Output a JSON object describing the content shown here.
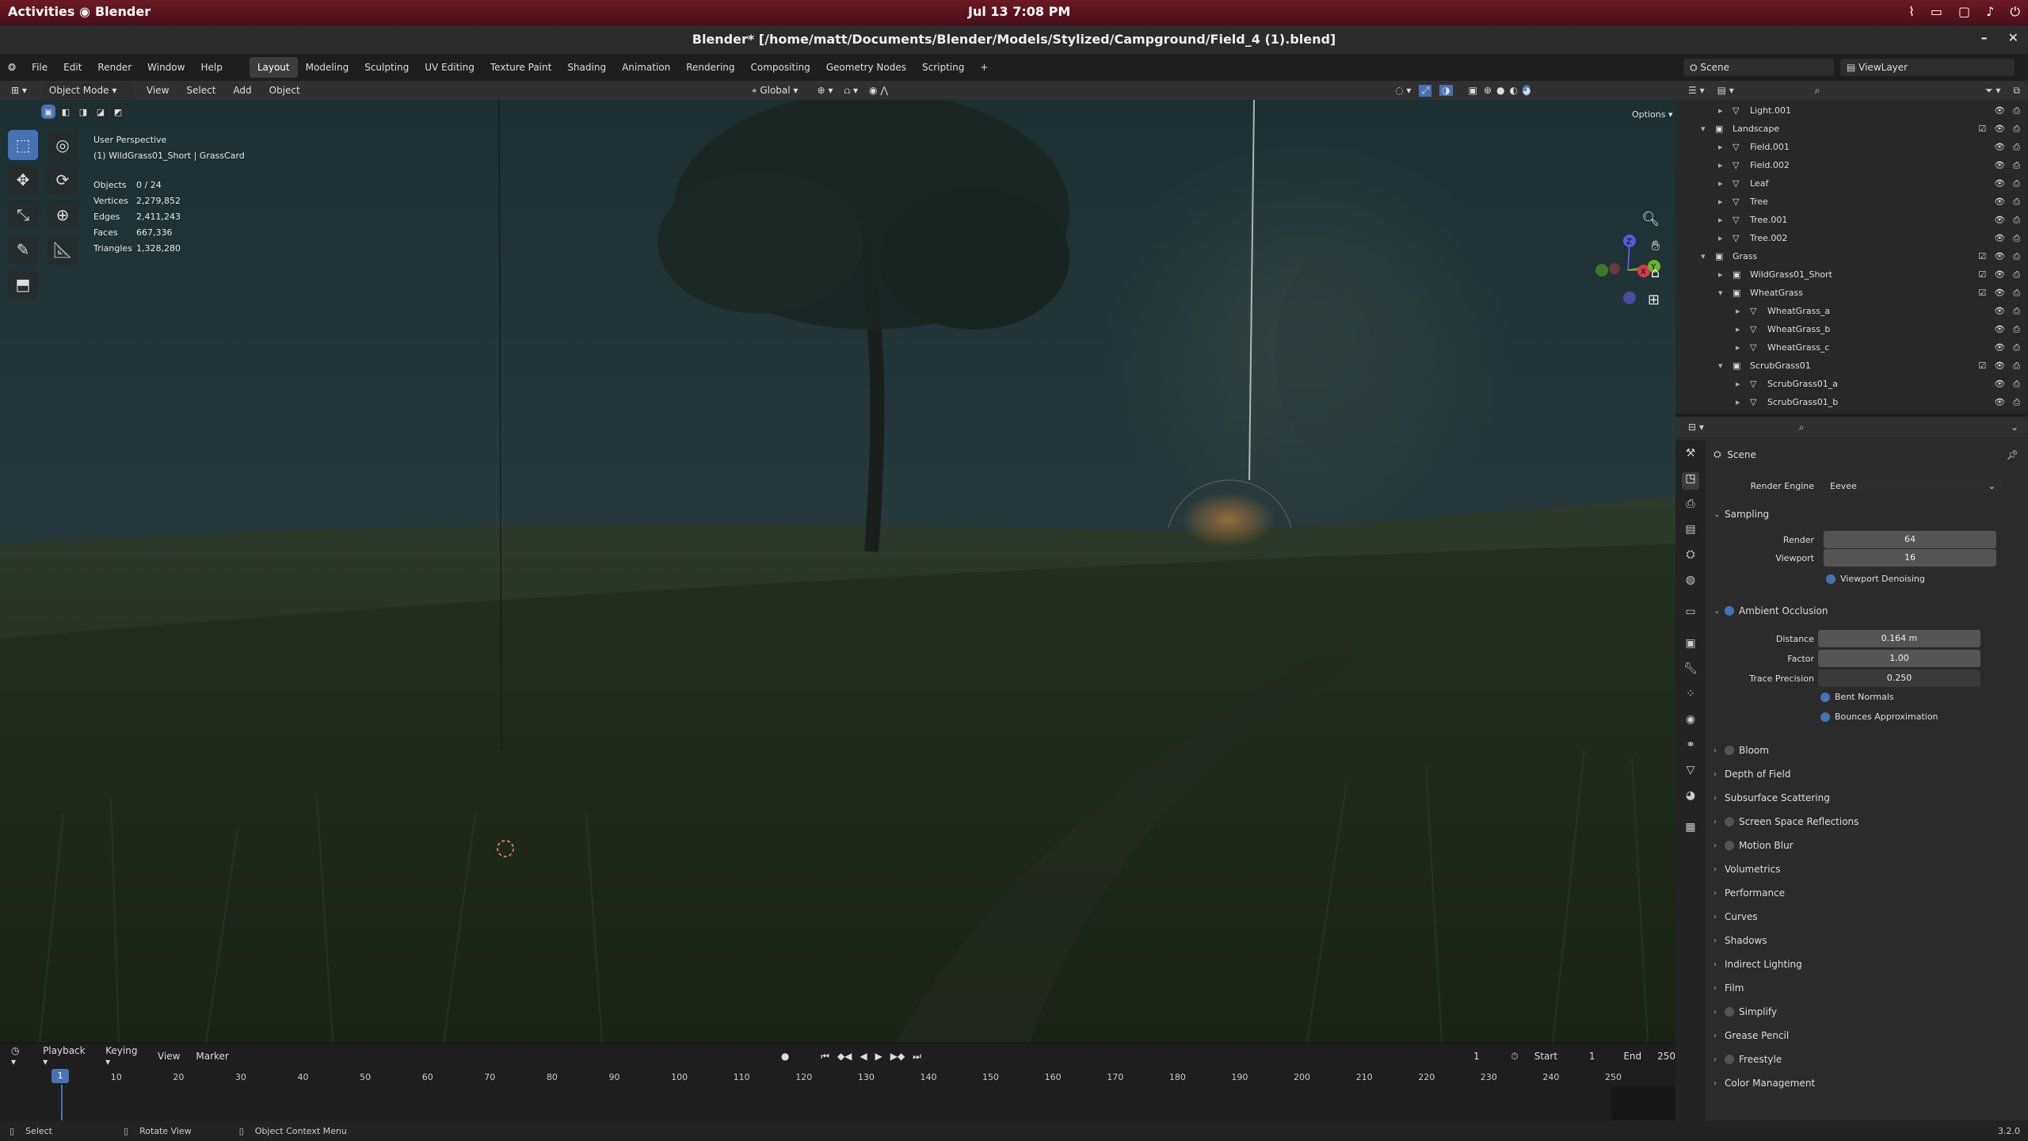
{
  "system": {
    "activities": "Activities",
    "app": "Blender",
    "clock": "Jul 13   7:08 PM"
  },
  "window": {
    "title": "Blender* [/home/matt/Documents/Blender/Models/Stylized/Campground/Field_4 (1).blend]",
    "minimize": "–",
    "close": "✕"
  },
  "menu": {
    "file": "File",
    "edit": "Edit",
    "render": "Render",
    "window": "Window",
    "help": "Help"
  },
  "workspaces": [
    "Layout",
    "Modeling",
    "Sculpting",
    "UV Editing",
    "Texture Paint",
    "Shading",
    "Animation",
    "Rendering",
    "Compositing",
    "Geometry Nodes",
    "Scripting"
  ],
  "scene": {
    "name": "Scene",
    "viewlayer": "ViewLayer"
  },
  "viewport_header": {
    "mode": "Object Mode",
    "view": "View",
    "select": "Select",
    "add": "Add",
    "object": "Object",
    "transform": "Global",
    "options": "Options"
  },
  "overlay": {
    "perspective": "User Perspective",
    "active": "(1) WildGrass01_Short | GrassCard",
    "stats": [
      {
        "k": "Objects",
        "v": "0 / 24"
      },
      {
        "k": "Vertices",
        "v": "2,279,852"
      },
      {
        "k": "Edges",
        "v": "2,411,243"
      },
      {
        "k": "Faces",
        "v": "667,336"
      },
      {
        "k": "Triangles",
        "v": "1,328,280"
      }
    ]
  },
  "gizmo": {
    "z": "Z",
    "x": "X",
    "y": "Y"
  },
  "timeline": {
    "playback": "Playback",
    "keying": "Keying",
    "view": "View",
    "marker": "Marker",
    "current": "1",
    "start_label": "Start",
    "start": "1",
    "end_label": "End",
    "end": "250",
    "ticks": [
      "1",
      "10",
      "20",
      "30",
      "40",
      "50",
      "60",
      "70",
      "80",
      "90",
      "100",
      "110",
      "120",
      "130",
      "140",
      "150",
      "160",
      "170",
      "180",
      "190",
      "200",
      "210",
      "220",
      "230",
      "240",
      "250"
    ]
  },
  "status": {
    "select": "Select",
    "rotate": "Rotate View",
    "context": "Object Context Menu",
    "version": "3.2.0"
  },
  "outliner": [
    {
      "indent": 2,
      "name": "Light.001",
      "exp": "▸"
    },
    {
      "indent": 1,
      "name": "Landscape",
      "exp": "▾",
      "coll": true
    },
    {
      "indent": 2,
      "name": "Field.001",
      "exp": "▸"
    },
    {
      "indent": 2,
      "name": "Field.002",
      "exp": "▸"
    },
    {
      "indent": 2,
      "name": "Leaf",
      "exp": "▸"
    },
    {
      "indent": 2,
      "name": "Tree",
      "exp": "▸"
    },
    {
      "indent": 2,
      "name": "Tree.001",
      "exp": "▸"
    },
    {
      "indent": 2,
      "name": "Tree.002",
      "exp": "▸"
    },
    {
      "indent": 1,
      "name": "Grass",
      "exp": "▾",
      "coll": true
    },
    {
      "indent": 2,
      "name": "WildGrass01_Short",
      "exp": "▸",
      "coll": true
    },
    {
      "indent": 2,
      "name": "WheatGrass",
      "exp": "▾",
      "coll": true
    },
    {
      "indent": 3,
      "name": "WheatGrass_a",
      "exp": "▸"
    },
    {
      "indent": 3,
      "name": "WheatGrass_b",
      "exp": "▸"
    },
    {
      "indent": 3,
      "name": "WheatGrass_c",
      "exp": "▸"
    },
    {
      "indent": 2,
      "name": "ScrubGrass01",
      "exp": "▾",
      "coll": true
    },
    {
      "indent": 3,
      "name": "ScrubGrass01_a",
      "exp": "▸"
    },
    {
      "indent": 3,
      "name": "ScrubGrass01_b",
      "exp": "▸"
    }
  ],
  "props": {
    "context": "Scene",
    "render_engine_label": "Render Engine",
    "render_engine": "Eevee",
    "sampling": "Sampling",
    "render_label": "Render",
    "render_val": "64",
    "viewport_label": "Viewport",
    "viewport_val": "16",
    "denoise": "Viewport Denoising",
    "ao": "Ambient Occlusion",
    "distance_label": "Distance",
    "distance": "0.164 m",
    "factor_label": "Factor",
    "factor": "1.00",
    "trace_label": "Trace Precision",
    "trace": "0.250",
    "bent": "Bent Normals",
    "bounces": "Bounces Approximation",
    "panels": [
      {
        "name": "Bloom",
        "toggle": true
      },
      {
        "name": "Depth of Field"
      },
      {
        "name": "Subsurface Scattering"
      },
      {
        "name": "Screen Space Reflections",
        "toggle": true
      },
      {
        "name": "Motion Blur",
        "toggle": true
      },
      {
        "name": "Volumetrics"
      },
      {
        "name": "Performance"
      },
      {
        "name": "Curves"
      },
      {
        "name": "Shadows"
      },
      {
        "name": "Indirect Lighting"
      },
      {
        "name": "Film"
      },
      {
        "name": "Simplify",
        "toggle": true
      },
      {
        "name": "Grease Pencil"
      },
      {
        "name": "Freestyle",
        "toggle": true
      },
      {
        "name": "Color Management"
      }
    ]
  },
  "colors": {
    "accent": "#4772b3",
    "titlebar": "#6b1a24"
  }
}
